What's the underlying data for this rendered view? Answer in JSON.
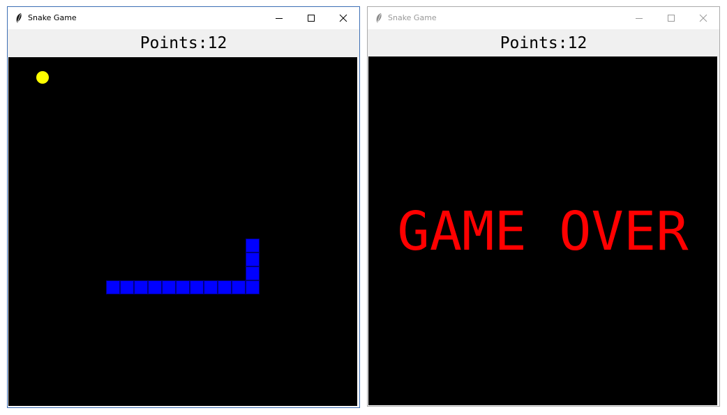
{
  "colors": {
    "canvas": "#000000",
    "snake": "#0000ff",
    "food": "#ffff00",
    "game_over": "#ff0000",
    "header_bg": "#f0f0f0"
  },
  "windows": [
    {
      "title": "Snake Game",
      "active": true,
      "points_label": "Points:12",
      "icons": [
        "feather-icon",
        "minimize-icon",
        "maximize-icon",
        "close-icon"
      ]
    },
    {
      "title": "Snake Game",
      "active": false,
      "points_label": "Points:12",
      "game_over_text": "GAME OVER",
      "icons": [
        "feather-icon",
        "minimize-icon",
        "maximize-icon",
        "close-icon"
      ]
    }
  ]
}
